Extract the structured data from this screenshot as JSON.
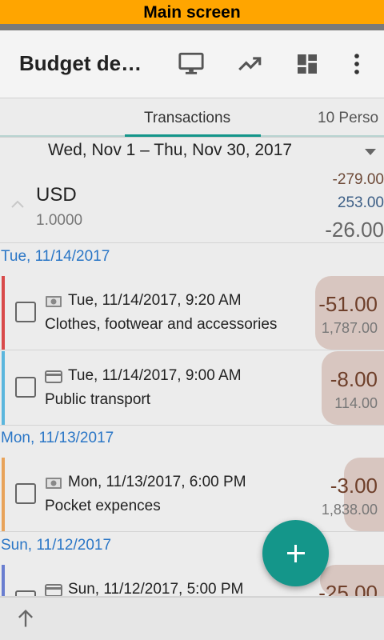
{
  "banner": {
    "label": "Main screen"
  },
  "toolbar": {
    "title": "Budget de…",
    "icons": [
      "monitor-icon",
      "trending-up-icon",
      "dashboard-icon",
      "more-vert-icon"
    ]
  },
  "tabs": [
    {
      "label": "Transactions",
      "active": true
    },
    {
      "label": "10 Perso",
      "active": false
    }
  ],
  "date_range": {
    "text": "Wed, Nov 1 – Thu, Nov 30, 2017"
  },
  "summary": {
    "currency": "USD",
    "rate": "1.0000",
    "expense": "-279.00",
    "income": "253.00",
    "net": "-26.00"
  },
  "groups": [
    {
      "date": "Tue, 11/14/2017",
      "transactions": [
        {
          "datetime": "Tue, 11/14/2017, 9:20 AM",
          "category": "Clothes, footwear and accessories",
          "amount": "-51.00",
          "balance": "1,787.00",
          "payment": "cash-icon",
          "color": "#d84a4a"
        },
        {
          "datetime": "Tue, 11/14/2017, 9:00 AM",
          "category": "Public transport",
          "amount": "-8.00",
          "balance": "114.00",
          "payment": "card-icon",
          "color": "#5bb6dd"
        }
      ]
    },
    {
      "date": "Mon, 11/13/2017",
      "transactions": [
        {
          "datetime": "Mon, 11/13/2017, 6:00 PM",
          "category": "Pocket expences",
          "amount": "-3.00",
          "balance": "1,838.00",
          "payment": "cash-icon",
          "color": "#e8a35a"
        }
      ]
    },
    {
      "date": "Sun, 11/12/2017",
      "transactions": [
        {
          "datetime": "Sun, 11/12/2017, 5:00 PM",
          "category": "",
          "amount": "-25.00",
          "balance": "",
          "payment": "card-icon",
          "color": "#6a7ed0"
        }
      ]
    }
  ],
  "fab": {
    "icon": "plus-icon"
  },
  "bottom": {
    "icon": "arrow-up-icon"
  },
  "colors": {
    "accent": "#14968a",
    "banner": "#ffa500",
    "date_header": "#2a76c6",
    "expense": "#6e3f2a",
    "income": "#3d5f86"
  }
}
